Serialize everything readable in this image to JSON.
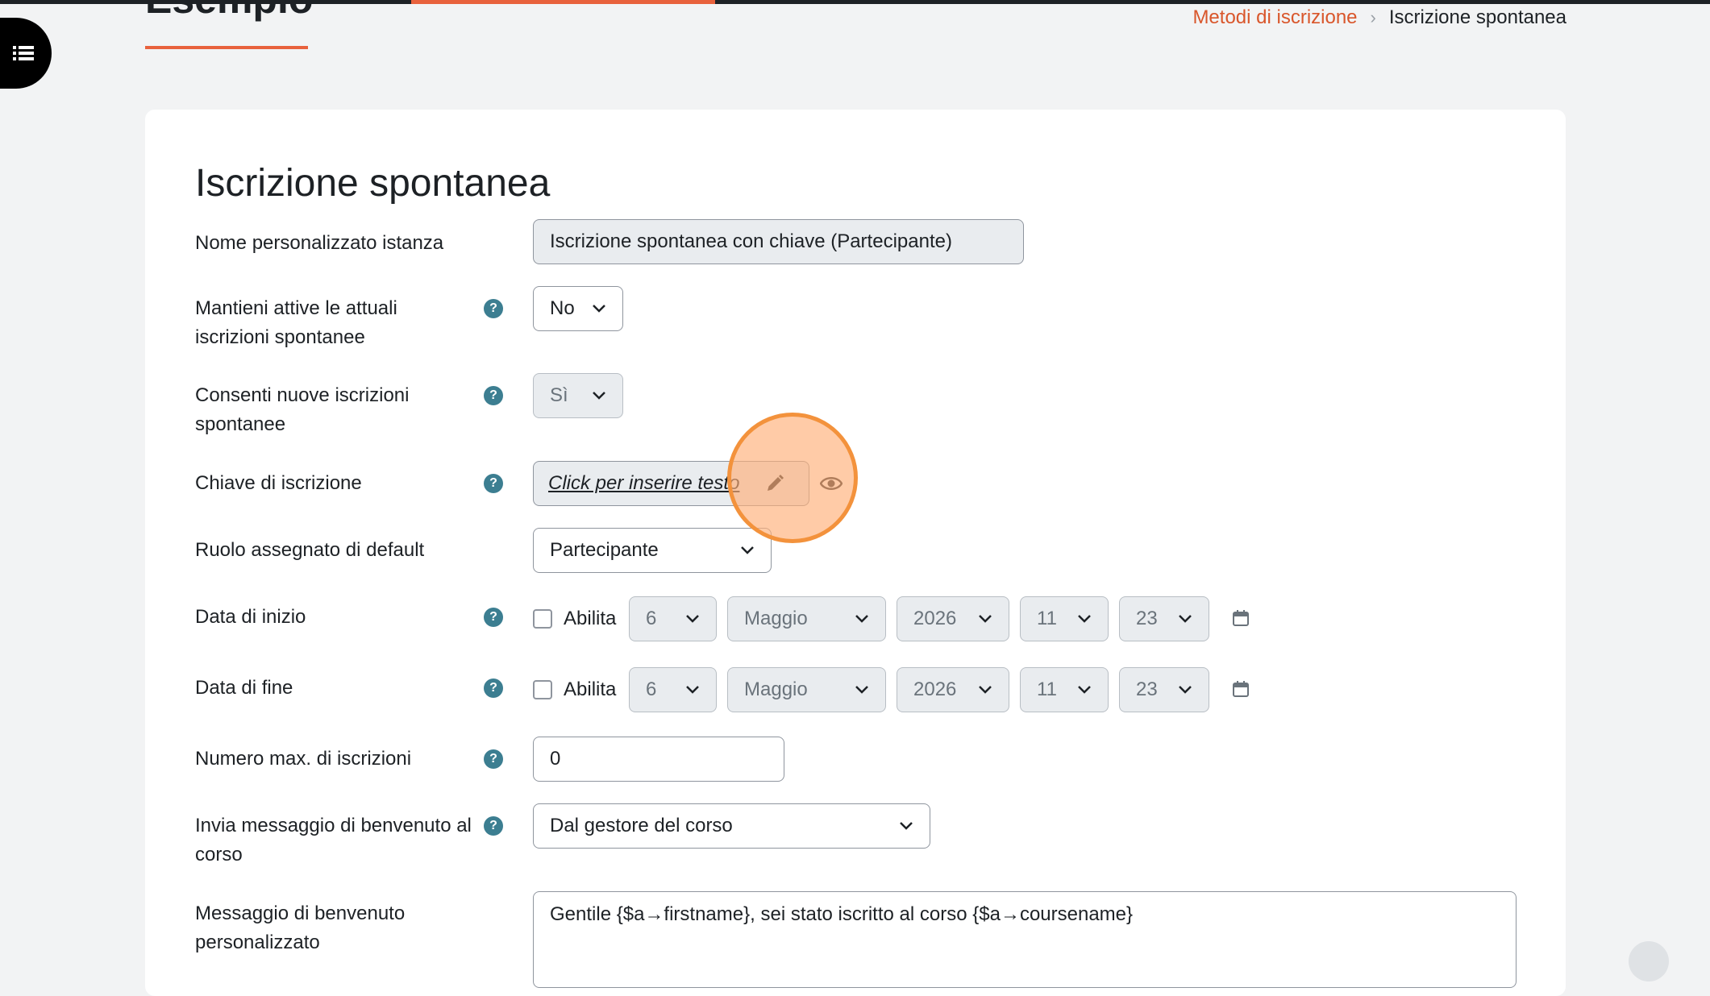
{
  "page": {
    "title": "Esempio",
    "breadcrumb": {
      "link": "Metodi di iscrizione",
      "current": "Iscrizione spontanea"
    }
  },
  "form": {
    "heading": "Iscrizione spontanea",
    "custom_name": {
      "label": "Nome personalizzato istanza",
      "value": "Iscrizione spontanea con chiave (Partecipante)"
    },
    "keep_active": {
      "label": "Mantieni attive le attuali iscrizioni spontanee",
      "value": "No"
    },
    "allow_new": {
      "label": "Consenti nuove iscrizioni spontanee",
      "value": "Sì"
    },
    "enrol_key": {
      "label": "Chiave di iscrizione",
      "placeholder": "Click per inserire testo"
    },
    "default_role": {
      "label": "Ruolo assegnato di default",
      "value": "Partecipante"
    },
    "start_date": {
      "label": "Data di inizio",
      "enable_label": "Abilita",
      "day": "6",
      "month": "Maggio",
      "year": "2026",
      "hour": "11",
      "minute": "23"
    },
    "end_date": {
      "label": "Data di fine",
      "enable_label": "Abilita",
      "day": "6",
      "month": "Maggio",
      "year": "2026",
      "hour": "11",
      "minute": "23"
    },
    "max_enrolled": {
      "label": "Numero max. di iscrizioni",
      "value": "0"
    },
    "welcome_message": {
      "label": "Invia messaggio di benvenuto al corso",
      "value": "Dal gestore del corso"
    },
    "custom_welcome": {
      "label": "Messaggio di benvenuto personalizzato",
      "value": "Gentile {$a→firstname}, sei stato iscritto al corso {$a→coursename}"
    },
    "help_glyph": "?"
  },
  "colors": {
    "accent": "#e8613c",
    "help_icon": "#3c7e91",
    "click_highlight": "#f3923c"
  },
  "icons": [
    "list-icon",
    "help-icon",
    "chevron-down-icon",
    "pencil-icon",
    "eye-icon",
    "calendar-icon"
  ]
}
